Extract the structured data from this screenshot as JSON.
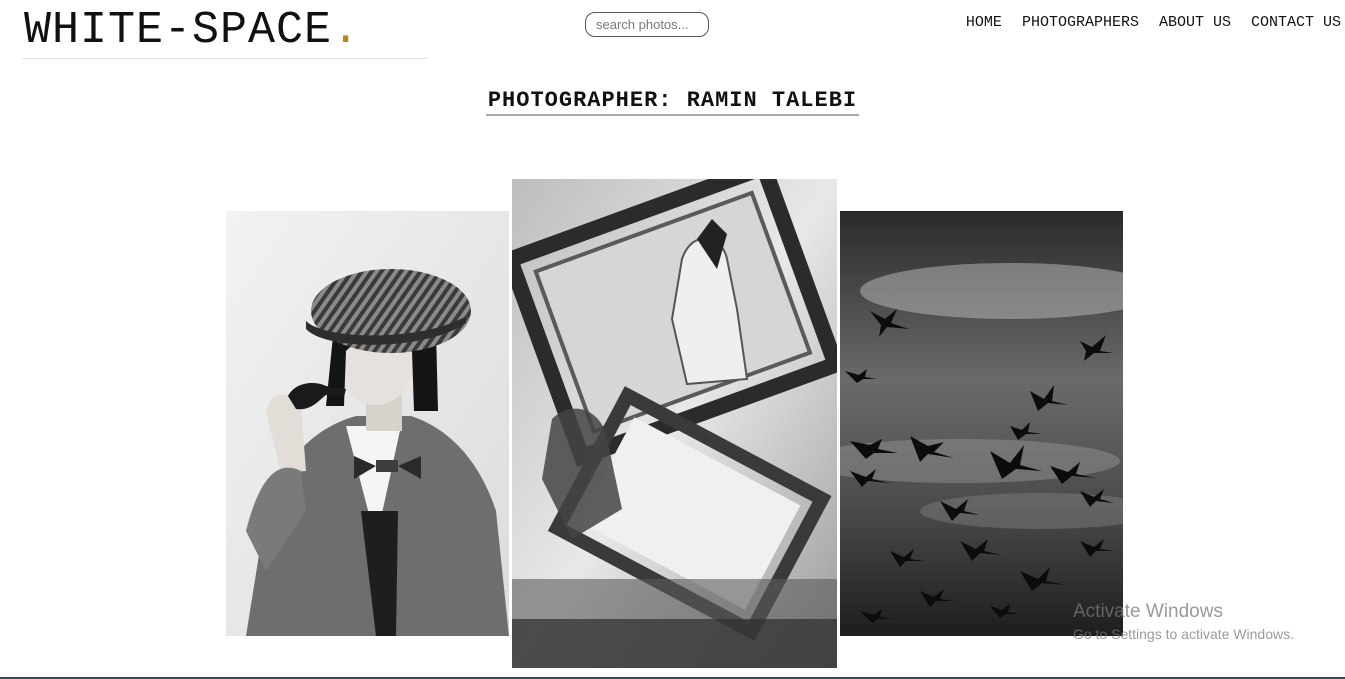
{
  "header": {
    "logo_text": "WHITE-SPACE",
    "logo_dot": ".",
    "search_placeholder": "search photos...",
    "nav": [
      "HOME",
      "PHOTOGRAPHERS",
      "ABOUT US",
      "CONTACT US"
    ]
  },
  "page_title": "PHOTOGRAPHER: RAMIN TALEBI",
  "photos": [
    {
      "subject": "woman in newsboy cap with pipe and bow tie"
    },
    {
      "subject": "hands holding ornate mirror frame"
    },
    {
      "subject": "birds flying against cloudy sky"
    }
  ],
  "watermark": {
    "title": "Activate Windows",
    "subtitle": "Go to Settings to activate Windows."
  },
  "colors": {
    "accent_dot": "#b8860b",
    "background": "#ffffff",
    "text": "#111111"
  }
}
